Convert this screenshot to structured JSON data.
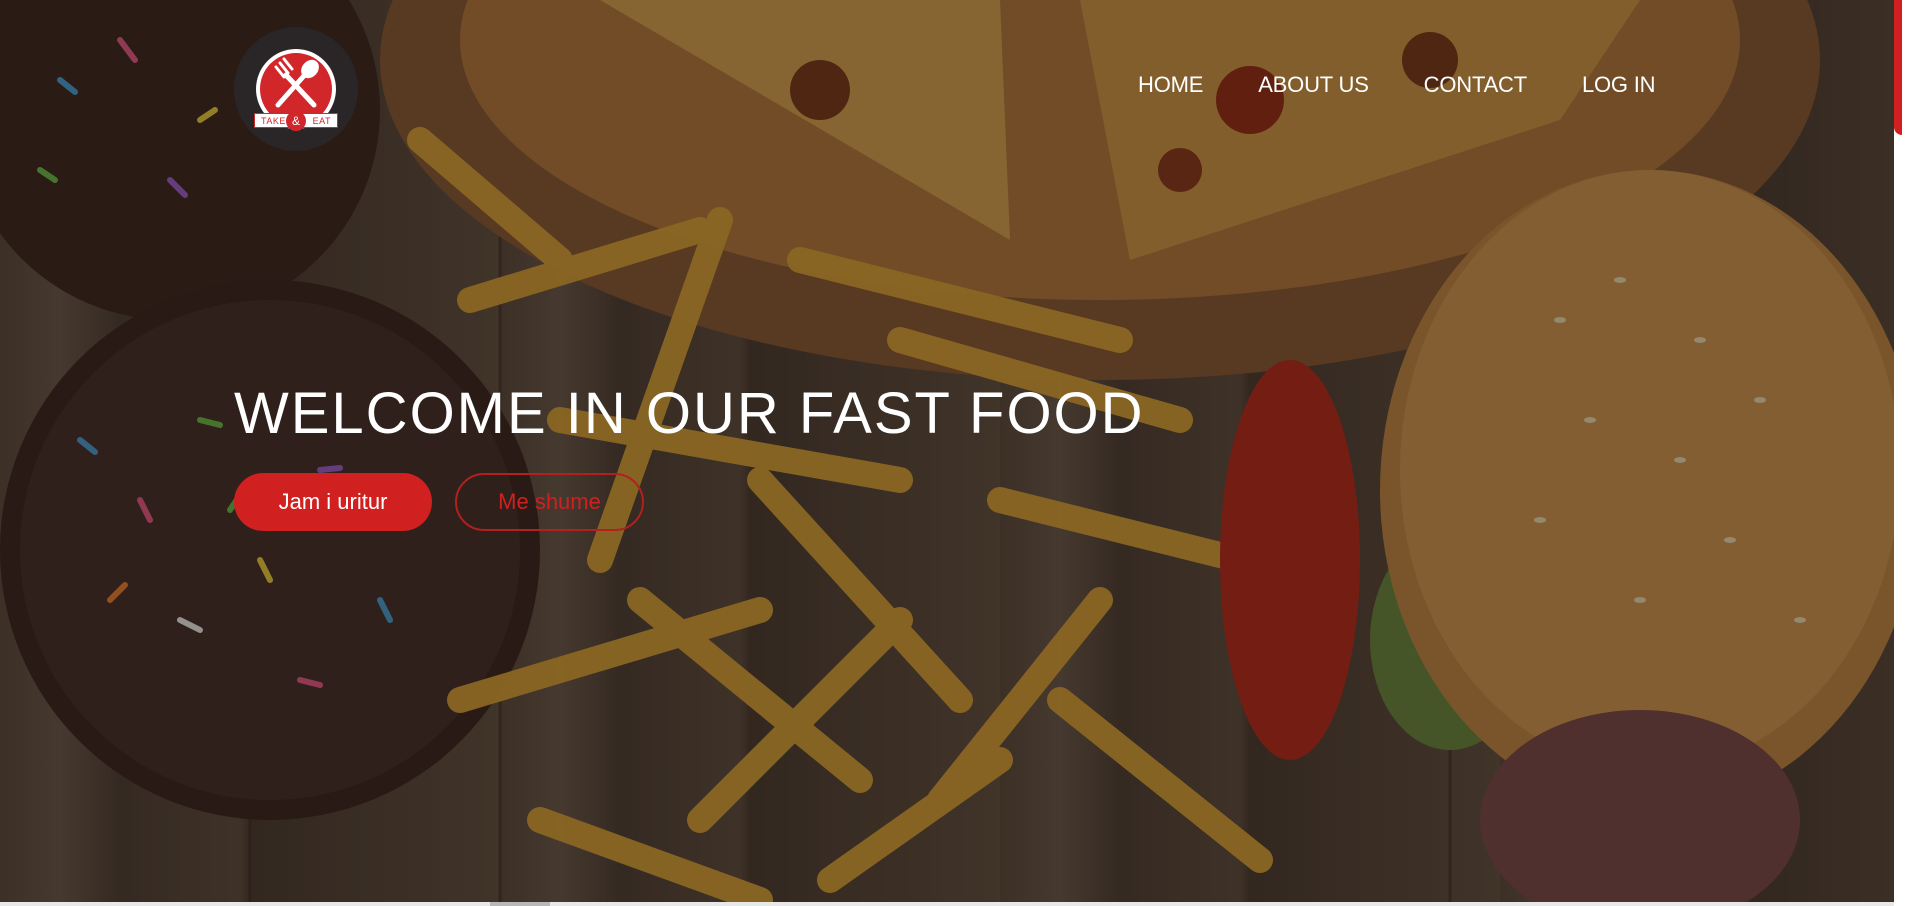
{
  "brand": {
    "logo_left": "TAKE",
    "logo_amp": "&",
    "logo_right": "EAT"
  },
  "nav": {
    "items": [
      "HOME",
      "ABOUT US",
      "CONTACT",
      "LOG IN"
    ]
  },
  "hero": {
    "title": "WELCOME IN OUR FAST FOOD",
    "primary_button": "Jam i uritur",
    "secondary_button": "Me shume"
  },
  "colors": {
    "accent": "#d0201f",
    "text": "#ffffff",
    "logo_bg": "#2a2628"
  },
  "icons": {
    "logo": "fork-spoon-icon"
  }
}
